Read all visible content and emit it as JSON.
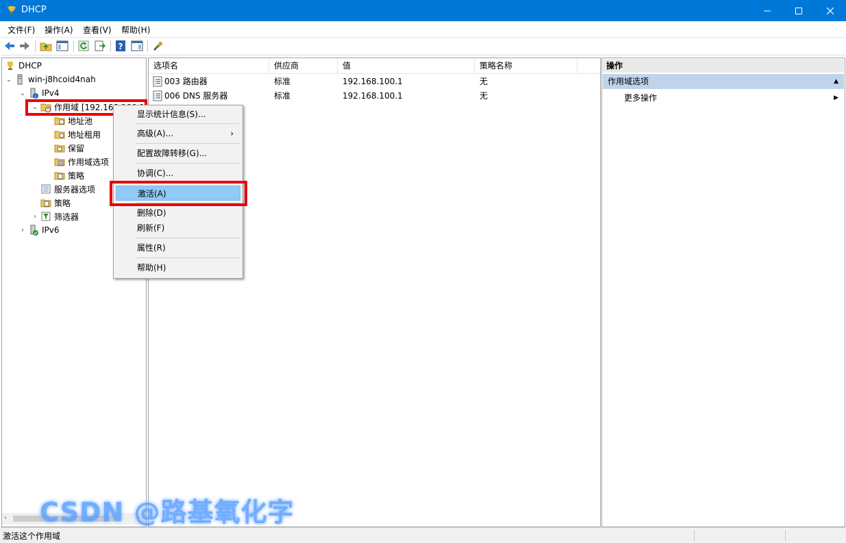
{
  "window": {
    "title": "DHCP",
    "controls": {
      "minimize": "—",
      "maximize": "☐",
      "close": "✕"
    }
  },
  "menubar": {
    "items": [
      {
        "label": "文件(F)"
      },
      {
        "label": "操作(A)"
      },
      {
        "label": "查看(V)"
      },
      {
        "label": "帮助(H)"
      }
    ]
  },
  "toolbar": {
    "icons": [
      "back-arrow-icon",
      "forward-arrow-icon",
      "up-folder-icon",
      "show-hide-console-tree-icon",
      "refresh-icon",
      "export-list-icon",
      "help-icon",
      "action-pane-icon",
      "server-connect-icon"
    ]
  },
  "tree": {
    "root": "DHCP",
    "server": "win-j8hcoid4nah",
    "ipv4": "IPv4",
    "scope": "作用域 [192.168.100.1]",
    "address_pool": "地址池",
    "address_leases": "地址租用",
    "reservations": "保留",
    "scope_options": "作用域选项",
    "scope_policies": "策略",
    "server_options": "服务器选项",
    "policies": "策略",
    "filters": "筛选器",
    "ipv6": "IPv6"
  },
  "list": {
    "columns": [
      "选项名",
      "供应商",
      "值",
      "策略名称"
    ],
    "rows": [
      {
        "name": "003 路由器",
        "vendor": "标准",
        "value": "192.168.100.1",
        "policy": "无"
      },
      {
        "name": "006 DNS 服务器",
        "vendor": "标准",
        "value": "192.168.100.1",
        "policy": "无"
      }
    ]
  },
  "context_menu": {
    "show_stats": "显示统计信息(S)...",
    "advanced": "高级(A)...",
    "failover": "配置故障转移(G)...",
    "reconcile": "协调(C)...",
    "activate": "激活(A)",
    "delete": "删除(D)",
    "refresh": "刷新(F)",
    "properties": "属性(R)",
    "help": "帮助(H)"
  },
  "actions": {
    "header": "操作",
    "section": "作用域选项",
    "more": "更多操作"
  },
  "statusbar": {
    "text": "激活这个作用域"
  },
  "watermark": {
    "text": "CSDN @路基氧化字"
  },
  "colors": {
    "titlebar": "#0078d7",
    "highlight": "#91c9f7",
    "annotation_red": "#e8000a",
    "action_section": "#bfd4ea"
  }
}
